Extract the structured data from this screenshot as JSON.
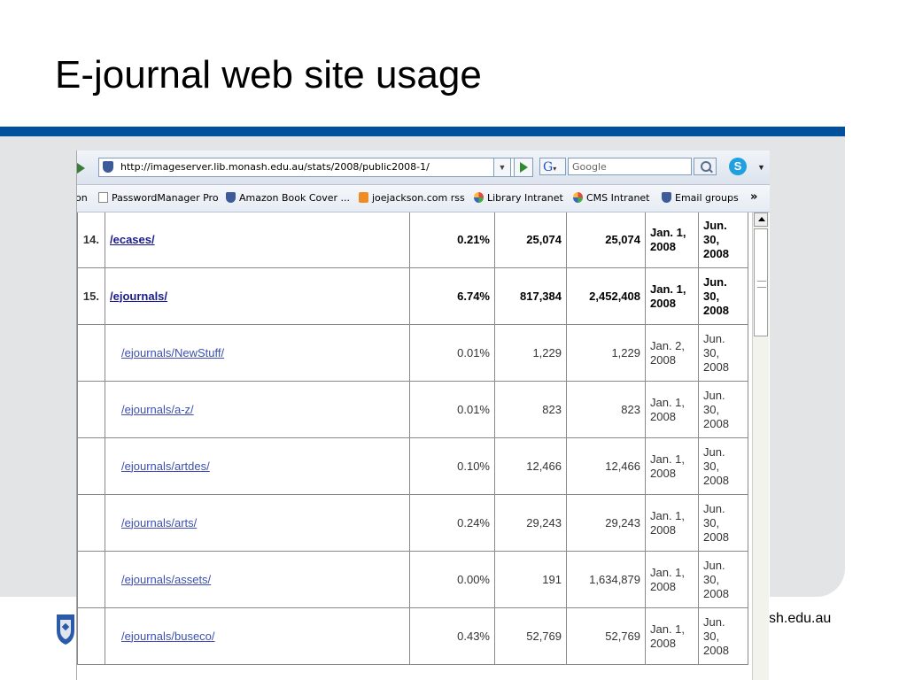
{
  "slide": {
    "title": "E-journal web site usage",
    "footer_url_fragment": "sh.edu.au"
  },
  "browser": {
    "url": "http://imageserver.lib.monash.edu.au/stats/2008/public2008-1/",
    "search_engine_label": "G",
    "search_placeholder": "Google",
    "links": [
      {
        "label": "on"
      },
      {
        "label": "PasswordManager Pro"
      },
      {
        "label": "Amazon Book Cover ..."
      },
      {
        "label": "joejackson.com rss"
      },
      {
        "label": "Library Intranet"
      },
      {
        "label": "CMS Intranet"
      },
      {
        "label": "Email groups"
      }
    ],
    "more_links": "»"
  },
  "table": {
    "rows": [
      {
        "index": "14.",
        "path": "/ecases/",
        "percent": "0.21%",
        "count1": "25,074",
        "count2": "25,074",
        "first": "Jan. 1, 2008",
        "last": "Jun. 30, 2008"
      },
      {
        "index": "15.",
        "path": "/ejournals/",
        "percent": "6.74%",
        "count1": "817,384",
        "count2": "2,452,408",
        "first": "Jan. 1, 2008",
        "last": "Jun. 30, 2008"
      },
      {
        "index": "",
        "path": "/ejournals/NewStuff/",
        "percent": "0.01%",
        "count1": "1,229",
        "count2": "1,229",
        "first": "Jan. 2, 2008",
        "last": "Jun. 30, 2008"
      },
      {
        "index": "",
        "path": "/ejournals/a-z/",
        "percent": "0.01%",
        "count1": "823",
        "count2": "823",
        "first": "Jan. 1, 2008",
        "last": "Jun. 30, 2008"
      },
      {
        "index": "",
        "path": "/ejournals/artdes/",
        "percent": "0.10%",
        "count1": "12,466",
        "count2": "12,466",
        "first": "Jan. 1, 2008",
        "last": "Jun. 30, 2008"
      },
      {
        "index": "",
        "path": "/ejournals/arts/",
        "percent": "0.24%",
        "count1": "29,243",
        "count2": "29,243",
        "first": "Jan. 1, 2008",
        "last": "Jun. 30, 2008"
      },
      {
        "index": "",
        "path": "/ejournals/assets/",
        "percent": "0.00%",
        "count1": "191",
        "count2": "1,634,879",
        "first": "Jan. 1, 2008",
        "last": "Jun. 30, 2008"
      },
      {
        "index": "",
        "path": "/ejournals/buseco/",
        "percent": "0.43%",
        "count1": "52,769",
        "count2": "52,769",
        "first": "Jan. 1, 2008",
        "last": "Jun. 30, 2008"
      }
    ]
  },
  "colors": {
    "brand_band": "#00509e",
    "panel_grey": "#e3e4e6",
    "link_blue": "#1a1a8c"
  },
  "icons": [
    "shield-icon",
    "dropdown-icon",
    "go-icon",
    "search-icon",
    "skype-icon",
    "document-icon",
    "rss-icon",
    "star-icon"
  ]
}
